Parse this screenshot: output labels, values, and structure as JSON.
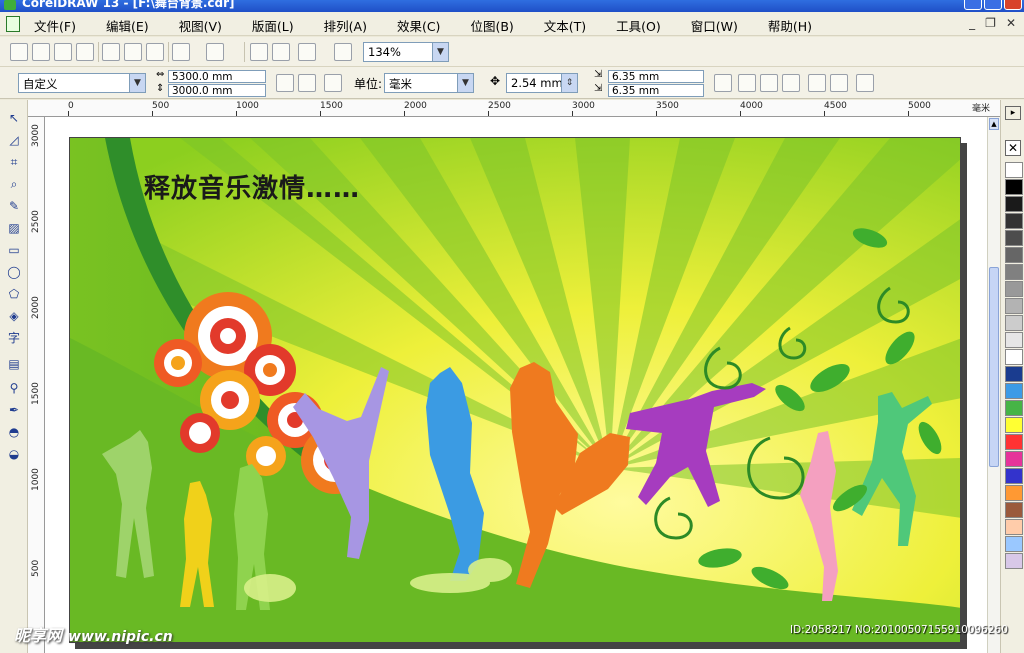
{
  "window": {
    "title": "CorelDRAW 13 - [F:\\舞台背景.cdr]"
  },
  "menu": [
    "文件(F)",
    "编辑(E)",
    "视图(V)",
    "版面(L)",
    "排列(A)",
    "效果(C)",
    "位图(B)",
    "文本(T)",
    "工具(O)",
    "窗口(W)",
    "帮助(H)"
  ],
  "toolbar": {
    "zoom": "134%"
  },
  "property_bar": {
    "paper_preset": "自定义",
    "width": "5300.0 mm",
    "height": "3000.0 mm",
    "units_label": "单位:",
    "units": "毫米",
    "nudge": "2.54 mm",
    "dup_x": "6.35 mm",
    "dup_y": "6.35 mm"
  },
  "ruler": {
    "h_ticks": [
      "0",
      "500",
      "1000",
      "1500",
      "2000",
      "2500",
      "3000",
      "3500",
      "4000",
      "4500",
      "5000"
    ],
    "h_unit": "毫米",
    "v_ticks": [
      "3000",
      "2500",
      "2000",
      "1500",
      "1000",
      "500"
    ]
  },
  "artwork": {
    "headline": "释放音乐激情……"
  },
  "palette": [
    "#ffffff",
    "#000000",
    "#1a1a1a",
    "#333333",
    "#4d4d4d",
    "#666666",
    "#808080",
    "#999999",
    "#b3b3b3",
    "#cccccc",
    "#e6e6e6",
    "#ffffff",
    "#1a3c8f",
    "#3c9be6",
    "#46b446",
    "#ffff33",
    "#ff3333",
    "#e6339a",
    "#3333cc",
    "#ff9933",
    "#9a5a3c",
    "#ffccaa",
    "#9ac8ff",
    "#d8c8e8"
  ],
  "watermark": {
    "site": "昵享网",
    "url": "www.nipic.cn",
    "id": "ID:2058217 NO:20100507155910096260"
  }
}
